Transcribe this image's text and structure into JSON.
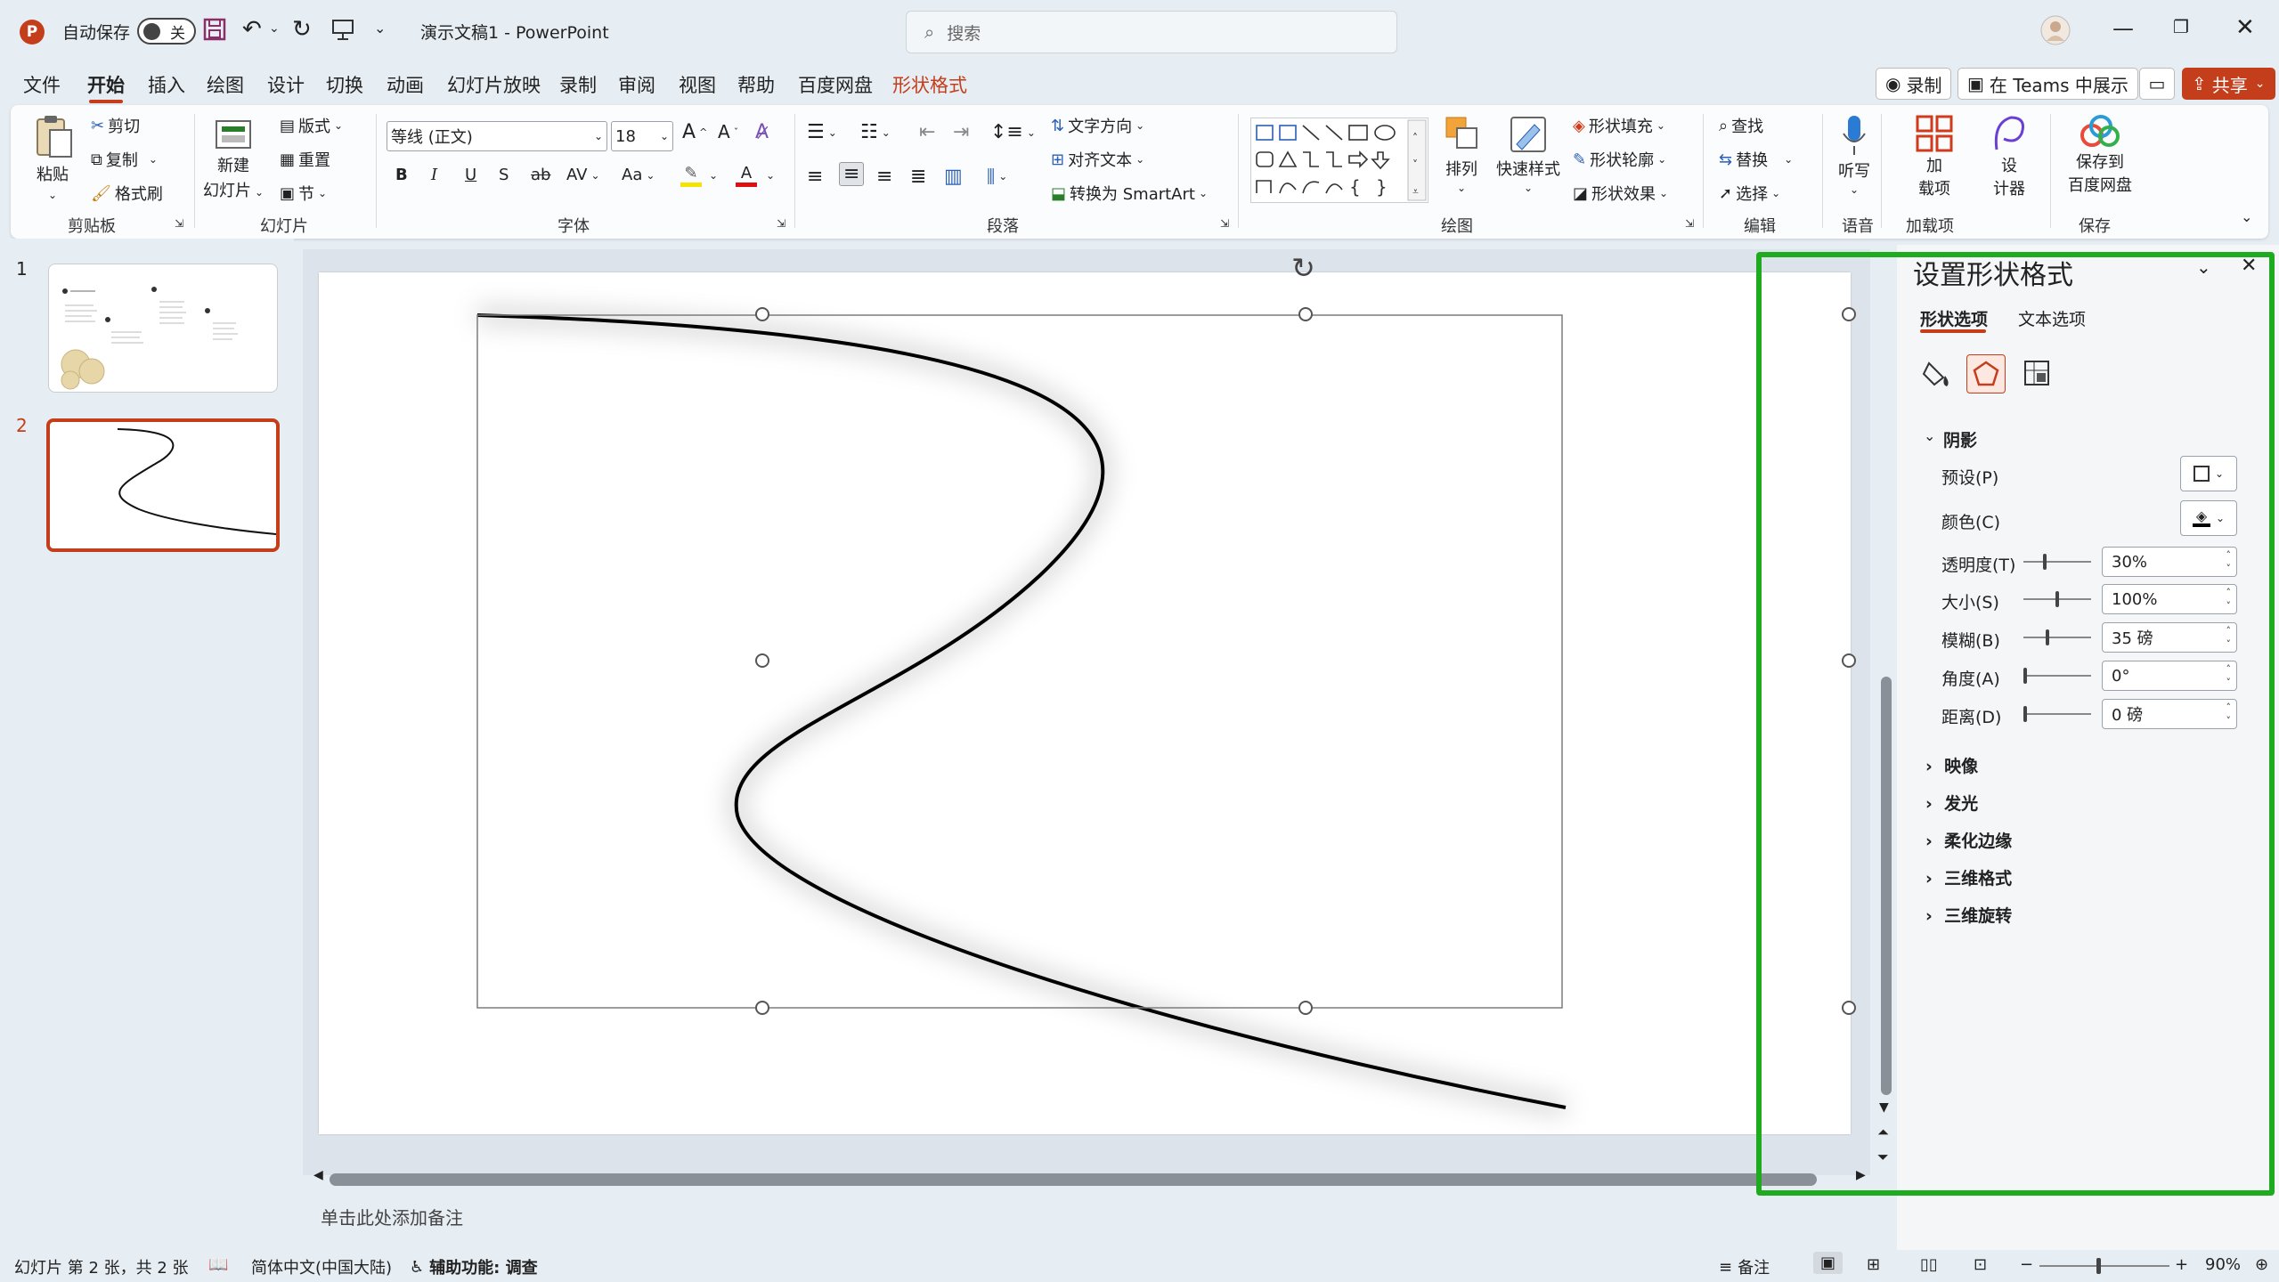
{
  "titlebar": {
    "app_logo": "P",
    "autosave_label": "自动保存",
    "autosave_state": "关",
    "doc_title": "演示文稿1  -  PowerPoint",
    "search_placeholder": "搜索"
  },
  "menu": {
    "items": [
      "文件",
      "开始",
      "插入",
      "绘图",
      "设计",
      "切换",
      "动画",
      "幻灯片放映",
      "录制",
      "审阅",
      "视图",
      "帮助",
      "百度网盘",
      "形状格式"
    ],
    "active": "开始",
    "record": "录制",
    "teams": "在 Teams 中展示",
    "share": "共享"
  },
  "ribbon": {
    "clipboard": {
      "paste": "粘贴",
      "cut": "剪切",
      "copy": "复制",
      "format_painter": "格式刷",
      "label": "剪贴板"
    },
    "slides": {
      "new_slide_line1": "新建",
      "new_slide_line2": "幻灯片",
      "layout": "版式",
      "reset": "重置",
      "section": "节",
      "label": "幻灯片"
    },
    "font": {
      "name": "等线 (正文)",
      "size": "18",
      "bold": "B",
      "italic": "I",
      "underline": "U",
      "shadow": "S",
      "strike": "ab",
      "spacing": "AV",
      "case": "Aa",
      "label": "字体"
    },
    "paragraph": {
      "text_direction": "文字方向",
      "align_text": "对齐文本",
      "smartart": "转换为 SmartArt",
      "label": "段落"
    },
    "drawing": {
      "arrange": "排列",
      "quick_styles": "快速样式",
      "shape_fill": "形状填充",
      "shape_outline": "形状轮廓",
      "shape_effects": "形状效果",
      "label": "绘图"
    },
    "editing": {
      "find": "查找",
      "replace": "替换",
      "select": "选择",
      "label": "编辑"
    },
    "voice": {
      "dictate": "听写",
      "label": "语音"
    },
    "addins": {
      "addins_line1": "加",
      "addins_line2": "载项",
      "designer_line1": "设",
      "designer_line2": "计器",
      "label": "加载项"
    },
    "save": {
      "save_line1": "保存到",
      "save_line2": "百度网盘",
      "label": "保存"
    }
  },
  "slides_panel": {
    "numbers": [
      "1",
      "2"
    ],
    "selected": 2
  },
  "format_pane": {
    "title": "设置形状格式",
    "tab_shape": "形状选项",
    "tab_text": "文本选项",
    "section_shadow": "阴影",
    "preset_label": "预设(P)",
    "color_label": "颜色(C)",
    "rows": [
      {
        "label": "透明度(T)",
        "value": "30%",
        "level": 0.3
      },
      {
        "label": "大小(S)",
        "value": "100%",
        "level": 0.5
      },
      {
        "label": "模糊(B)",
        "value": "35 磅",
        "level": 0.35
      },
      {
        "label": "角度(A)",
        "value": "0°",
        "level": 0.0
      },
      {
        "label": "距离(D)",
        "value": "0 磅",
        "level": 0.0
      }
    ],
    "collapsed_sections": [
      "映像",
      "发光",
      "柔化边缘",
      "三维格式",
      "三维旋转"
    ]
  },
  "notes_placeholder": "单击此处添加备注",
  "status": {
    "slide_info": "幻灯片 第 2 张，共 2 张",
    "language": "简体中文(中国大陆)",
    "accessibility": "辅助功能: 调查",
    "notes": "备注",
    "zoom": "90%"
  },
  "colors": {
    "accent": "#c43e1c",
    "highlight_frame": "#1fab1f"
  }
}
